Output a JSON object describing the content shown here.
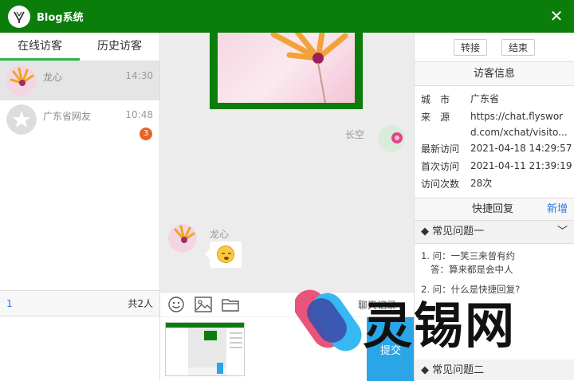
{
  "app": {
    "title": "Blog系统"
  },
  "tabs": [
    {
      "label": "在线访客"
    },
    {
      "label": "历史访客"
    }
  ],
  "visitors": [
    {
      "name": "龙心",
      "time": "14:30"
    },
    {
      "name": "广东省网友",
      "time": "10:48",
      "badge": "3"
    }
  ],
  "left_footer": {
    "page": "1",
    "total": "共2人"
  },
  "chat": {
    "sender_name": "长空",
    "receiver_name": "龙心"
  },
  "toolbar": {
    "history": "聊天记录"
  },
  "input": {
    "submit": "提交"
  },
  "right": {
    "transfer": "转接",
    "end": "结束",
    "info_title": "访客信息",
    "info": [
      {
        "key": "城　市",
        "value": "广东省"
      },
      {
        "key": "来　源",
        "value": "https://chat.flyswor d.com/xchat/visito..."
      },
      {
        "key": "最新访问",
        "value": "2021-04-18 14:29:57"
      },
      {
        "key": "首次访问",
        "value": "2021-04-11 21:39:19"
      },
      {
        "key": "访问次数",
        "value": "28次"
      }
    ],
    "quick_reply": "快捷回复",
    "add_new": "新增",
    "section1": "常见问题一",
    "faq": [
      "1. 问：一笑三来曾有约",
      "答：算来都是会中人",
      "2. 问：什么是快捷回复?"
    ],
    "section2": "常见问题二"
  },
  "watermark": {
    "text": "灵锡网"
  },
  "colors": {
    "titlebar": "#0a7d0a",
    "accent": "#2db44d",
    "submit": "#2aa6e6",
    "badge": "#e9622a"
  }
}
